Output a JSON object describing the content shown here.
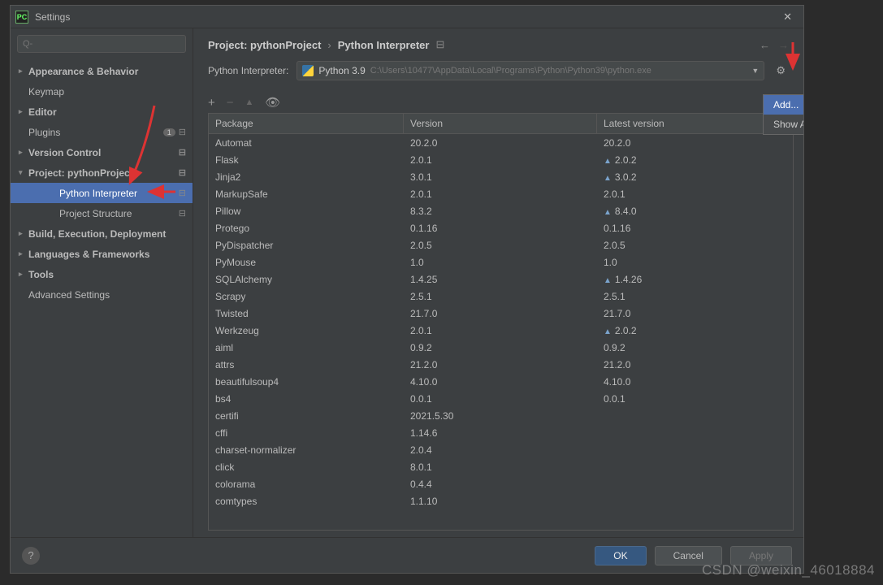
{
  "window": {
    "title": "Settings",
    "logo_text": "PC"
  },
  "search": {
    "placeholder": "Q-"
  },
  "sidebar": {
    "items": [
      {
        "label": "Appearance & Behavior",
        "bold": true,
        "arrow": "▸"
      },
      {
        "label": "Keymap"
      },
      {
        "label": "Editor",
        "bold": true,
        "arrow": "▸"
      },
      {
        "label": "Plugins",
        "badge": "1",
        "proj": "⊟"
      },
      {
        "label": "Version Control",
        "bold": true,
        "arrow": "▸",
        "proj": "⊟"
      },
      {
        "label": "Project: pythonProject",
        "bold": true,
        "arrow": "▾",
        "proj": "⊟"
      },
      {
        "label": "Python Interpreter",
        "indent": true,
        "selected": true,
        "proj": "⊟"
      },
      {
        "label": "Project Structure",
        "indent": true,
        "proj": "⊟"
      },
      {
        "label": "Build, Execution, Deployment",
        "bold": true,
        "arrow": "▸"
      },
      {
        "label": "Languages & Frameworks",
        "bold": true,
        "arrow": "▸"
      },
      {
        "label": "Tools",
        "bold": true,
        "arrow": "▸"
      },
      {
        "label": "Advanced Settings"
      }
    ]
  },
  "breadcrumb": {
    "project": "Project: pythonProject",
    "sep": "›",
    "interp": "Python Interpreter"
  },
  "interpreter": {
    "label": "Python Interpreter:",
    "name": "Python 3.9",
    "path": "C:\\Users\\10477\\AppData\\Local\\Programs\\Python\\Python39\\python.exe"
  },
  "toolbar": {
    "add": "+",
    "remove": "−",
    "up": "▲",
    "eye": "👁"
  },
  "columns": {
    "package": "Package",
    "version": "Version",
    "latest": "Latest version"
  },
  "packages": [
    {
      "name": "Automat",
      "version": "20.2.0",
      "latest": "20.2.0"
    },
    {
      "name": "Flask",
      "version": "2.0.1",
      "latest": "2.0.2",
      "upgrade": true
    },
    {
      "name": "Jinja2",
      "version": "3.0.1",
      "latest": "3.0.2",
      "upgrade": true
    },
    {
      "name": "MarkupSafe",
      "version": "2.0.1",
      "latest": "2.0.1"
    },
    {
      "name": "Pillow",
      "version": "8.3.2",
      "latest": "8.4.0",
      "upgrade": true
    },
    {
      "name": "Protego",
      "version": "0.1.16",
      "latest": "0.1.16"
    },
    {
      "name": "PyDispatcher",
      "version": "2.0.5",
      "latest": "2.0.5"
    },
    {
      "name": "PyMouse",
      "version": "1.0",
      "latest": "1.0"
    },
    {
      "name": "SQLAlchemy",
      "version": "1.4.25",
      "latest": "1.4.26",
      "upgrade": true
    },
    {
      "name": "Scrapy",
      "version": "2.5.1",
      "latest": "2.5.1"
    },
    {
      "name": "Twisted",
      "version": "21.7.0",
      "latest": "21.7.0"
    },
    {
      "name": "Werkzeug",
      "version": "2.0.1",
      "latest": "2.0.2",
      "upgrade": true
    },
    {
      "name": "aiml",
      "version": "0.9.2",
      "latest": "0.9.2"
    },
    {
      "name": "attrs",
      "version": "21.2.0",
      "latest": "21.2.0"
    },
    {
      "name": "beautifulsoup4",
      "version": "4.10.0",
      "latest": "4.10.0"
    },
    {
      "name": "bs4",
      "version": "0.0.1",
      "latest": "0.0.1"
    },
    {
      "name": "certifi",
      "version": "2021.5.30",
      "latest": ""
    },
    {
      "name": "cffi",
      "version": "1.14.6",
      "latest": ""
    },
    {
      "name": "charset-normalizer",
      "version": "2.0.4",
      "latest": ""
    },
    {
      "name": "click",
      "version": "8.0.1",
      "latest": ""
    },
    {
      "name": "colorama",
      "version": "0.4.4",
      "latest": ""
    },
    {
      "name": "comtypes",
      "version": "1.1.10",
      "latest": ""
    }
  ],
  "menu": {
    "add": "Add...",
    "show_all": "Show All..."
  },
  "buttons": {
    "ok": "OK",
    "cancel": "Cancel",
    "apply": "Apply"
  },
  "watermark": "CSDN @weixin_46018884"
}
